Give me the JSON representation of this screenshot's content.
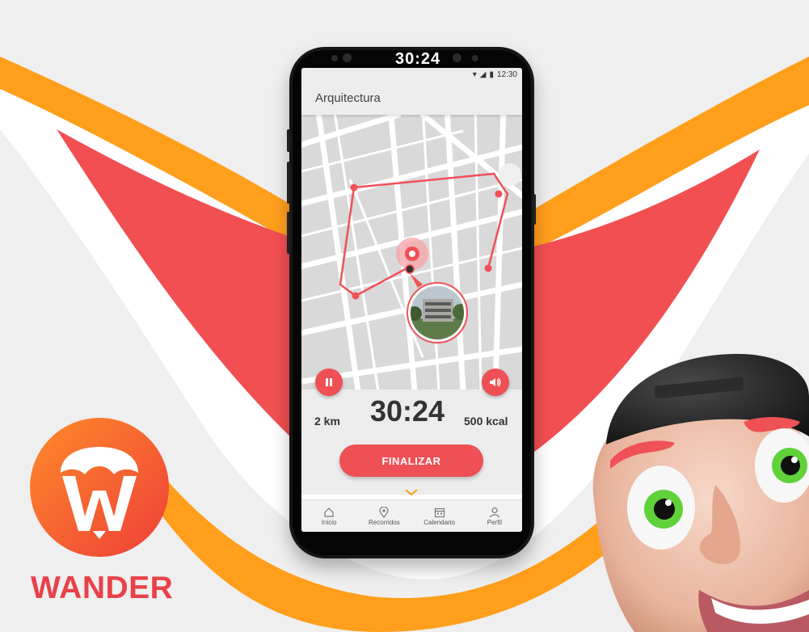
{
  "brand": {
    "name": "WANDER"
  },
  "phone": {
    "top_timer": "30:24",
    "status_time": "12:30",
    "app_title": "Arquitectura",
    "stats": {
      "distance": "2 km",
      "time": "30:24",
      "calories": "500 kcal"
    },
    "finish_label": "FINALIZAR",
    "nav": [
      {
        "label": "Inicio",
        "icon": "home-icon"
      },
      {
        "label": "Recorridos",
        "icon": "location-pin-icon"
      },
      {
        "label": "Calendario",
        "icon": "calendar-icon"
      },
      {
        "label": "Perfil",
        "icon": "user-icon"
      }
    ]
  },
  "colors": {
    "accent": "#ee5055",
    "orange": "#ff9f1c",
    "red": "#f24f52",
    "background": "#efefef"
  },
  "icons": {
    "pause": "pause-icon",
    "sound": "speaker-icon",
    "expand": "chevron-down-icon"
  }
}
